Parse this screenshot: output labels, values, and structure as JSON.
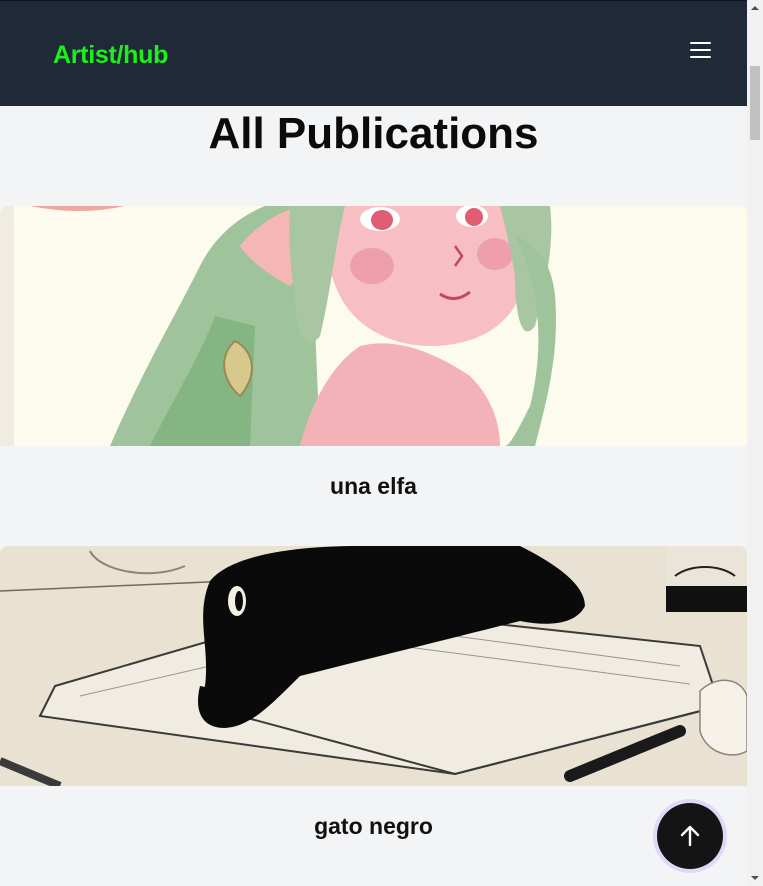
{
  "header": {
    "brand": "Artist/hub",
    "brand_color": "#1bf01b",
    "background": "#1f2937",
    "menu_icon": "hamburger-menu-icon"
  },
  "main": {
    "title": "All Publications",
    "publications": [
      {
        "title": "una elfa",
        "image": "illustration of an elf girl with green hair and pink skin"
      },
      {
        "title": "gato negro",
        "image": "black cat lying on an open book next to an ink bottle"
      }
    ]
  },
  "back_to_top": {
    "icon": "arrow-up-icon"
  }
}
